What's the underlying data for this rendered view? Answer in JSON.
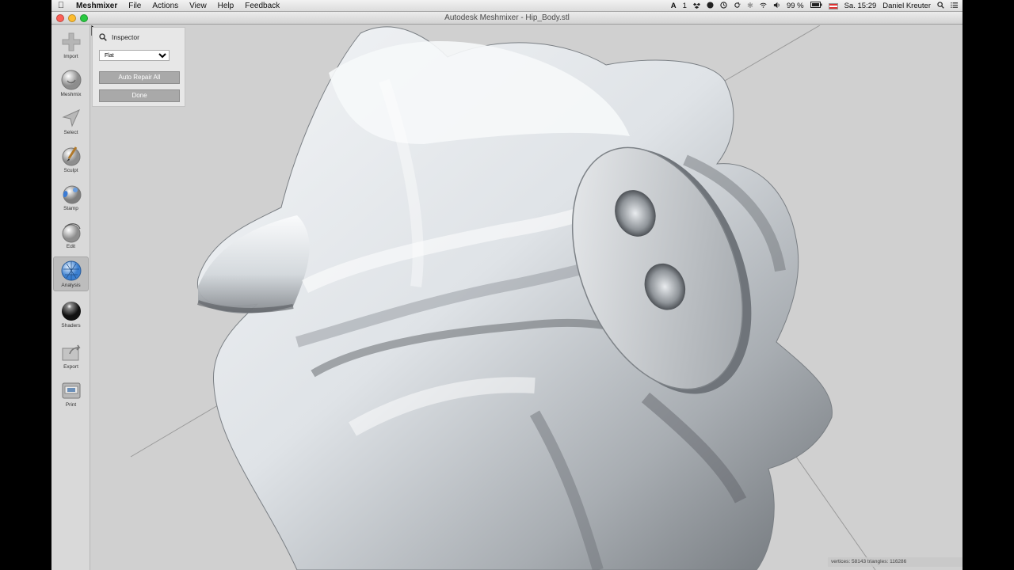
{
  "menubar": {
    "app_name": "Meshmixer",
    "menus": [
      "File",
      "Actions",
      "View",
      "Help",
      "Feedback"
    ],
    "battery": "99 %",
    "clock": "Sa. 15:29",
    "user": "Daniel Kreuter",
    "input_indicator": "1"
  },
  "window": {
    "title": "Autodesk Meshmixer - Hip_Body.stl"
  },
  "toolbar": {
    "items": [
      {
        "label": "Import",
        "icon": "plus-icon"
      },
      {
        "label": "Meshmix",
        "icon": "meshmix-icon"
      },
      {
        "label": "Select",
        "icon": "select-arrow-icon"
      },
      {
        "label": "Sculpt",
        "icon": "brush-icon"
      },
      {
        "label": "Stamp",
        "icon": "stamp-icon"
      },
      {
        "label": "Edit",
        "icon": "edit-sphere-icon"
      },
      {
        "label": "Analysis",
        "icon": "analysis-sphere-icon"
      },
      {
        "label": "Shaders",
        "icon": "shader-ball-icon"
      },
      {
        "label": "Export",
        "icon": "export-icon"
      },
      {
        "label": "Print",
        "icon": "print-icon"
      }
    ],
    "active": "Analysis"
  },
  "inspector": {
    "title": "Inspector",
    "mode_value": "Flat",
    "auto_repair_label": "Auto Repair All",
    "done_label": "Done"
  },
  "status": {
    "text": "vertices: 58143 triangles: 116286"
  },
  "colors": {
    "menubar": "#e8e8e8",
    "viewport_bg": "#d0d0d0",
    "mesh_light": "#f4f6f8",
    "mesh_shadow": "#6e7378",
    "button_gray": "#a9a9a9",
    "close_red": "#fc5f57",
    "minimize_yellow": "#fdbc2e",
    "zoom_green": "#28c940"
  }
}
